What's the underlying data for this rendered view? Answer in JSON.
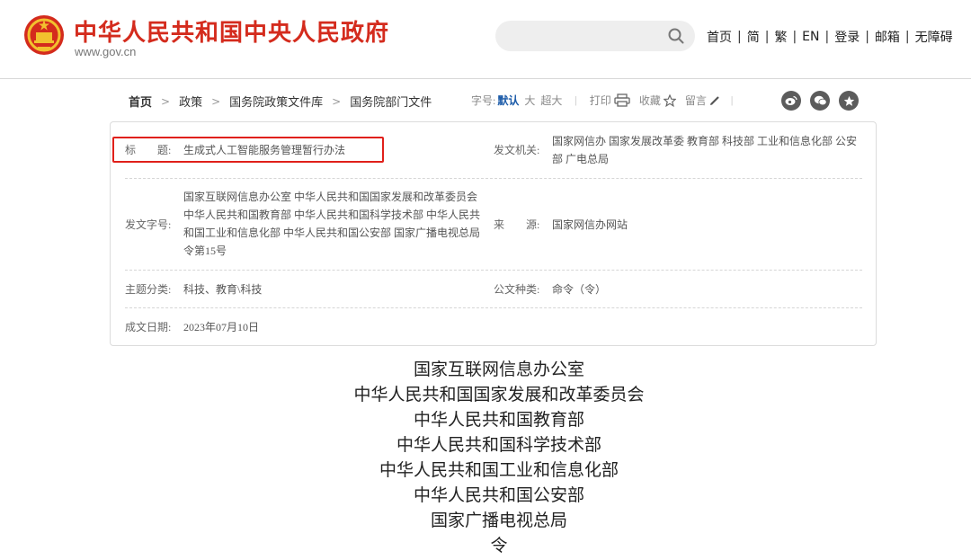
{
  "header": {
    "site_title": "中华人民共和国中央人民政府",
    "site_url": "www.gov.cn",
    "search_placeholder": "",
    "nav": [
      "首页",
      "简",
      "繁",
      "EN",
      "登录",
      "邮箱",
      "无障碍"
    ],
    "nav_separator": "|",
    "emblem_icon": "national-emblem-icon",
    "accent_color": "#d42b1d"
  },
  "breadcrumb": {
    "items": [
      "首页",
      "政策",
      "国务院政策文件库",
      "国务院部门文件"
    ],
    "separator": ">"
  },
  "tools": {
    "font_size_label": "字号:",
    "font_sizes": [
      "默认",
      "大",
      "超大"
    ],
    "print_label": "打印",
    "favorite_label": "收藏",
    "comment_label": "留言",
    "divider": "|",
    "share_icons": [
      "weibo-icon",
      "wechat-icon",
      "qzone-icon"
    ]
  },
  "info": {
    "title_label": "标　　题:",
    "title_value": "生成式人工智能服务管理暂行办法",
    "issuer_label": "发文机关:",
    "issuer_value": "国家网信办 国家发展改革委 教育部 科技部 工业和信息化部 公安部 广电总局",
    "doc_no_label": "发文字号:",
    "doc_no_value": "国家互联网信息办公室 中华人民共和国国家发展和改革委员会 中华人民共和国教育部 中华人民共和国科学技术部 中华人民共和国工业和信息化部 中华人民共和国公安部 国家广播电视总局令第15号",
    "source_label": "来　　源:",
    "source_value": "国家网信办网站",
    "topic_label": "主题分类:",
    "topic_value": "科技、教育\\科技",
    "doc_type_label": "公文种类:",
    "doc_type_value": "命令（令）",
    "date_label": "成文日期:",
    "date_value": "2023年07月10日",
    "highlight_color": "#e0201a"
  },
  "body": {
    "issuers": [
      "国家互联网信息办公室",
      "中华人民共和国国家发展和改革委员会",
      "中华人民共和国教育部",
      "中华人民共和国科学技术部",
      "中华人民共和国工业和信息化部",
      "中华人民共和国公安部",
      "国家广播电视总局",
      "令"
    ]
  }
}
